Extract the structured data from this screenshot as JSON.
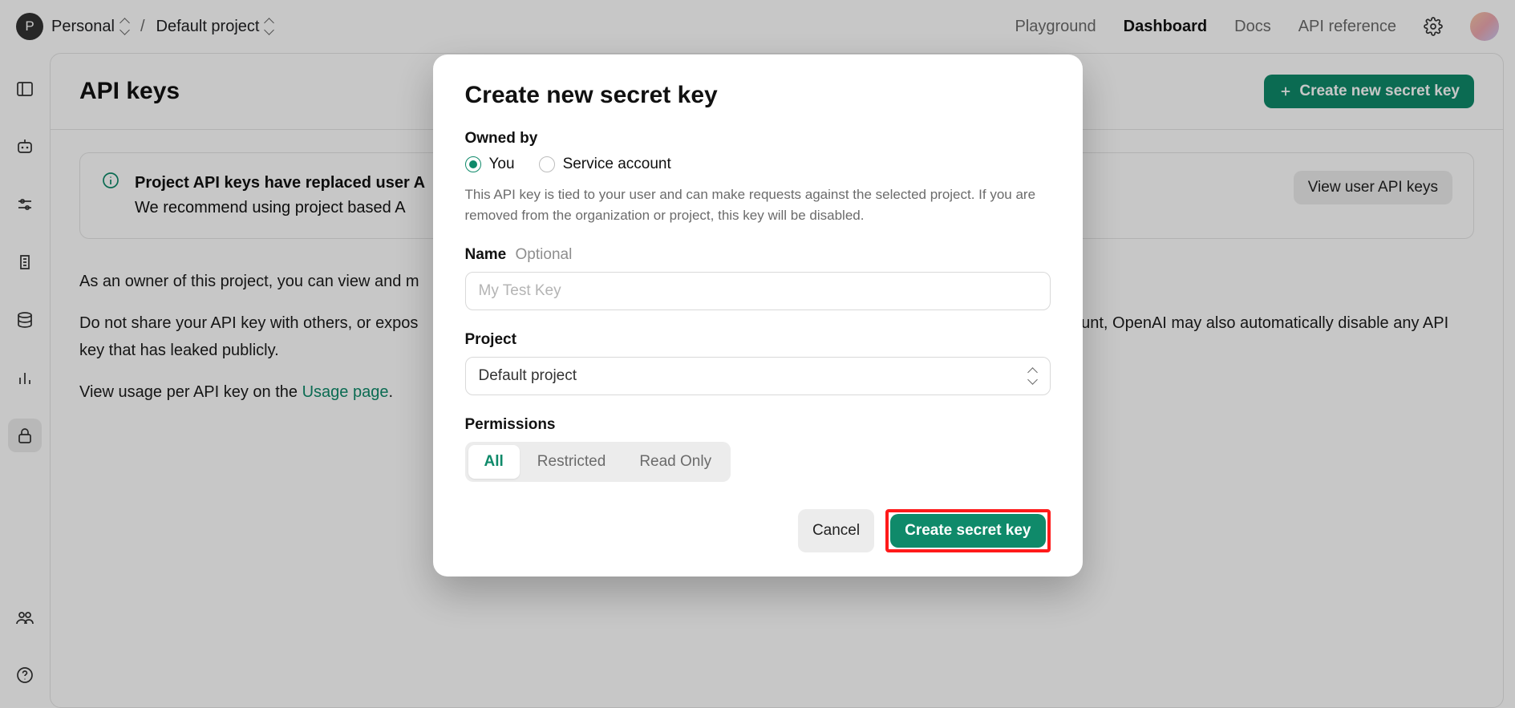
{
  "header": {
    "org_initial": "P",
    "org_name": "Personal",
    "project_name": "Default project",
    "nav": {
      "playground": "Playground",
      "dashboard": "Dashboard",
      "docs": "Docs",
      "api_ref": "API reference"
    }
  },
  "page": {
    "title": "API keys",
    "create_button": "Create new secret key",
    "callout_bold": "Project API keys have replaced user A",
    "callout_body": "We recommend using project based A",
    "view_user_keys": "View user API keys",
    "para1": "As an owner of this project, you can view and m",
    "para2a": "Do not share your API key with others, or expos",
    "para2b": "count, OpenAI may also automatically disable any API key that has leaked publicly.",
    "para3a": "View usage per API key on the ",
    "para3_link": "Usage page",
    "para3b": "."
  },
  "modal": {
    "title": "Create new secret key",
    "owned_by_label": "Owned by",
    "radio_you": "You",
    "radio_service": "Service account",
    "help": "This API key is tied to your user and can make requests against the selected project. If you are removed from the organization or project, this key will be disabled.",
    "name_label": "Name",
    "name_optional": "Optional",
    "name_placeholder": "My Test Key",
    "project_label": "Project",
    "project_value": "Default project",
    "permissions_label": "Permissions",
    "perm_all": "All",
    "perm_restricted": "Restricted",
    "perm_readonly": "Read Only",
    "cancel": "Cancel",
    "create": "Create secret key"
  }
}
